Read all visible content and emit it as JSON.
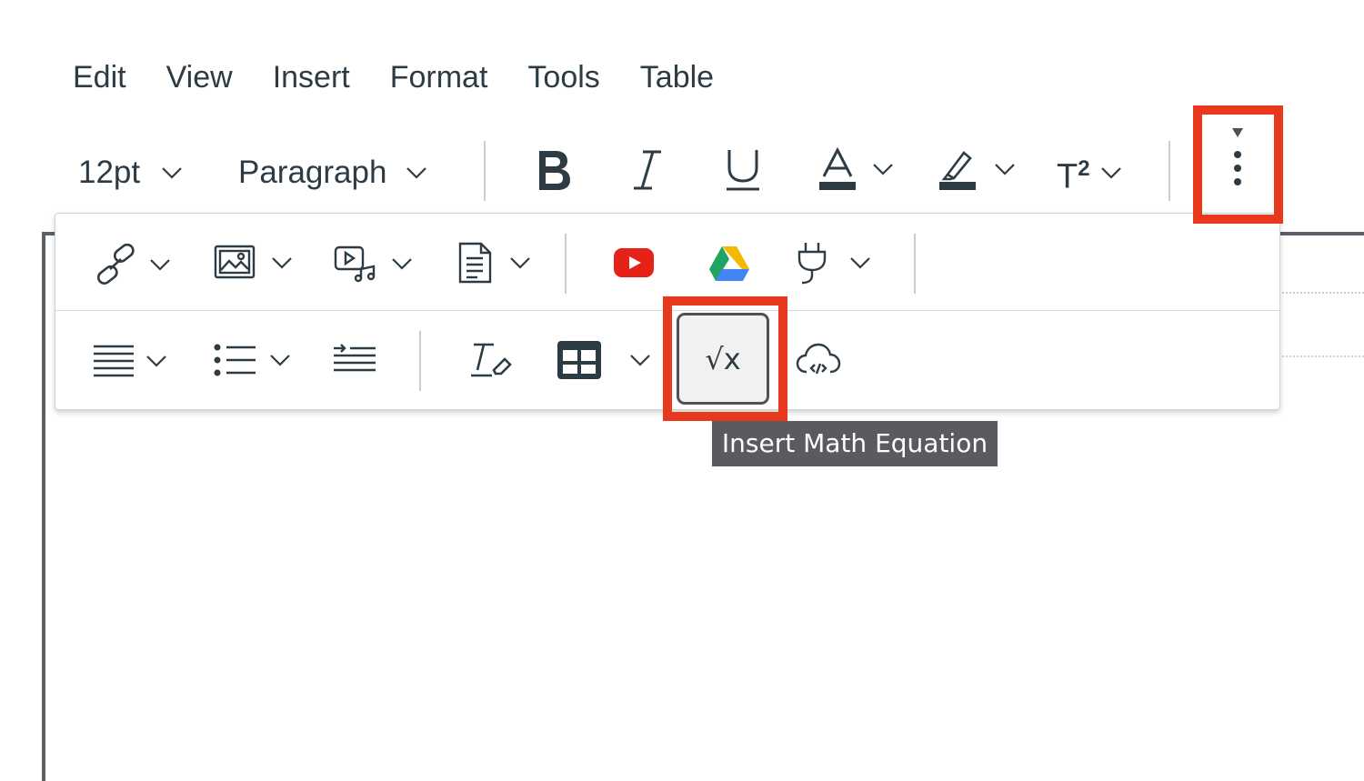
{
  "menubar": {
    "items": [
      "Edit",
      "View",
      "Insert",
      "Format",
      "Tools",
      "Table"
    ]
  },
  "toolbar": {
    "font_size": "12pt",
    "block_format": "Paragraph",
    "superscript_label": "T",
    "superscript_exponent": "2"
  },
  "math_button": {
    "glyph": "√x"
  },
  "tooltip": {
    "text": "Insert Math Equation"
  },
  "colors": {
    "highlight_border": "#e8391e",
    "youtube_red": "#e62117",
    "text_dark": "#2d3b45",
    "tooltip_bg": "#595b5f"
  },
  "icons": {
    "toolbar": [
      "bold-icon",
      "italic-icon",
      "underline-icon",
      "text-color-icon",
      "highlight-icon",
      "superscript-icon",
      "more-options-icon"
    ],
    "overflow_row1": [
      "link-icon",
      "image-icon",
      "media-icon",
      "document-icon",
      "youtube-icon",
      "google-drive-icon",
      "plugin-icon"
    ],
    "overflow_row2": [
      "align-icon",
      "list-icon",
      "indent-icon",
      "clear-formatting-icon",
      "table-icon",
      "math-equation-icon",
      "cloud-embed-icon"
    ]
  }
}
